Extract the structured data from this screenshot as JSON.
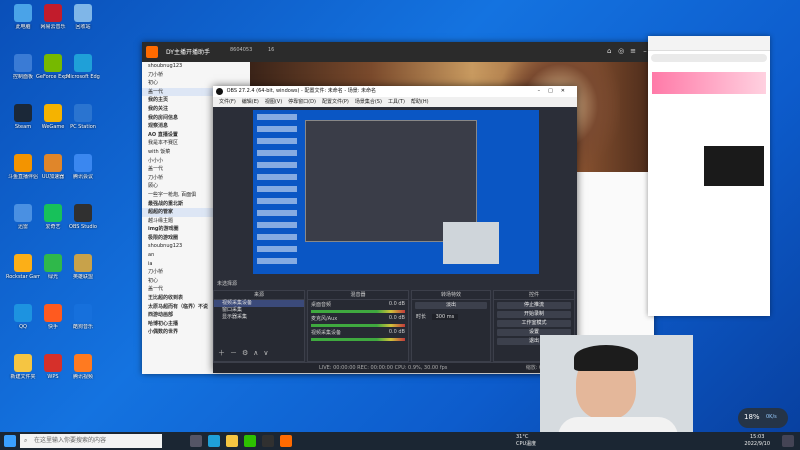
{
  "desktop": {
    "icons": [
      {
        "label": "此电脑",
        "color": "#4aa3e8"
      },
      {
        "label": "网易云音乐",
        "color": "#c21c2c"
      },
      {
        "label": "回收站",
        "color": "#7fb6e8"
      },
      {
        "label": "控制面板",
        "color": "#3a7bd5"
      },
      {
        "label": "GeForce Experience",
        "color": "#76b900"
      },
      {
        "label": "Microsoft Edge",
        "color": "#1fa0d8"
      },
      {
        "label": "Steam",
        "color": "#1b2838"
      },
      {
        "label": "WeGame",
        "color": "#f5b300"
      },
      {
        "label": "PC Station",
        "color": "#2a74d0"
      },
      {
        "label": "斗鱼直播伴侣",
        "color": "#f39400"
      },
      {
        "label": "UU加速器",
        "color": "#e0862a"
      },
      {
        "label": "腾讯会议",
        "color": "#3a87f0"
      },
      {
        "label": "迅雷",
        "color": "#4a90e2"
      },
      {
        "label": "爱奇艺",
        "color": "#17c15a"
      },
      {
        "label": "OBS Studio",
        "color": "#303030"
      },
      {
        "label": "Rockstar Games Launcher",
        "color": "#fcaf17"
      },
      {
        "label": "绿光",
        "color": "#2fb84a"
      },
      {
        "label": "英雄联盟",
        "color": "#c8a24a"
      },
      {
        "label": "QQ",
        "color": "#1d93e0"
      },
      {
        "label": "快手",
        "color": "#ff5a1f"
      },
      {
        "label": "酷狗音乐",
        "color": "#1670dc"
      },
      {
        "label": "新建文件夹",
        "color": "#f5c542"
      },
      {
        "label": "WPS",
        "color": "#d6302a"
      },
      {
        "label": "腾讯视频",
        "color": "#ff7a20"
      }
    ]
  },
  "dy_window": {
    "title": "DY主播开播助手",
    "room_id": "8604053",
    "count": "16",
    "sidebar_rows": [
      {
        "text": "shoubnug123",
        "type": "item"
      },
      {
        "text": "刀小桥",
        "type": "item"
      },
      {
        "text": "初心",
        "type": "item"
      },
      {
        "text": "盖一代",
        "type": "item hl"
      },
      {
        "text": "我的主页",
        "type": "group"
      },
      {
        "text": "我的关注",
        "type": "group"
      },
      {
        "text": "我的房间信息",
        "type": "group"
      },
      {
        "text": "观察消息",
        "type": "group"
      },
      {
        "text": "AO 直播设置",
        "type": "group"
      },
      {
        "text": "我是本不赛区",
        "type": "item"
      },
      {
        "text": "with 饭菜",
        "type": "item"
      },
      {
        "text": "小小小",
        "type": "item"
      },
      {
        "text": "盖一代",
        "type": "item"
      },
      {
        "text": "刀小桥",
        "type": "item"
      },
      {
        "text": "顾心",
        "type": "item"
      },
      {
        "text": "一些字一枪炮, 百面俱",
        "type": "item"
      },
      {
        "text": "最强战的重北斯",
        "type": "group"
      },
      {
        "text": "超超的管家",
        "type": "group hl"
      },
      {
        "text": "越斗缘主题",
        "type": "item"
      },
      {
        "text": "img的游戏圈",
        "type": "group"
      },
      {
        "text": "极限的游戏圈",
        "type": "group"
      },
      {
        "text": "shoubnug123",
        "type": "item"
      },
      {
        "text": "an",
        "type": "item"
      },
      {
        "text": "ia",
        "type": "item"
      },
      {
        "text": "刀小桥",
        "type": "item"
      },
      {
        "text": "初心",
        "type": "item"
      },
      {
        "text": "盖一代",
        "type": "item"
      },
      {
        "text": "王比超的收到表",
        "type": "group"
      },
      {
        "text": "太原马超而有（临界）不说",
        "type": "group"
      },
      {
        "text": "西游动画部",
        "type": "group"
      },
      {
        "text": "哈博初心主播",
        "type": "group"
      },
      {
        "text": "小偶数的世界",
        "type": "group"
      }
    ]
  },
  "obs_window": {
    "title": "OBS 27.2.4 (64-bit, windows) - 配置文件: 未命名 - 场景: 未命名",
    "menu": [
      "文件(F)",
      "编辑(E)",
      "视图(V)",
      "停靠窗口(D)",
      "配置文件(P)",
      "场景集合(S)",
      "工具(T)",
      "帮助(H)"
    ],
    "no_source": "未选择源",
    "sources_header": "来源",
    "mixer_header": "混音器",
    "transitions_header": "转场特效",
    "controls_header": "控件",
    "sources": [
      "视频采集设备",
      "窗口采集",
      "显示器采集"
    ],
    "mixer": [
      {
        "name": "桌面音频",
        "db": "0.0 dB"
      },
      {
        "name": "麦克风/Aux",
        "db": "0.0 dB"
      },
      {
        "name": "视频采集设备",
        "db": "0.0 dB"
      }
    ],
    "transition_type": "淡出",
    "duration_label": "时长",
    "duration_value": "300 ms",
    "controls": [
      "停止推流",
      "开始录制",
      "工作室模式",
      "设置",
      "退出"
    ],
    "status": "LIVE: 00:00:00   REC: 00:00:00   CPU: 0.9%, 30.00 fps",
    "status_right": "缩放: 0  帧  (0.0%)"
  },
  "taskbar": {
    "search_placeholder": "在这里输入你要搜索的内容",
    "temp": "31°C",
    "cpu_label": "CPU温度",
    "time": "15:03",
    "date": "2022/9/10"
  },
  "widget": {
    "percent": "18%",
    "net": "0K/s"
  }
}
